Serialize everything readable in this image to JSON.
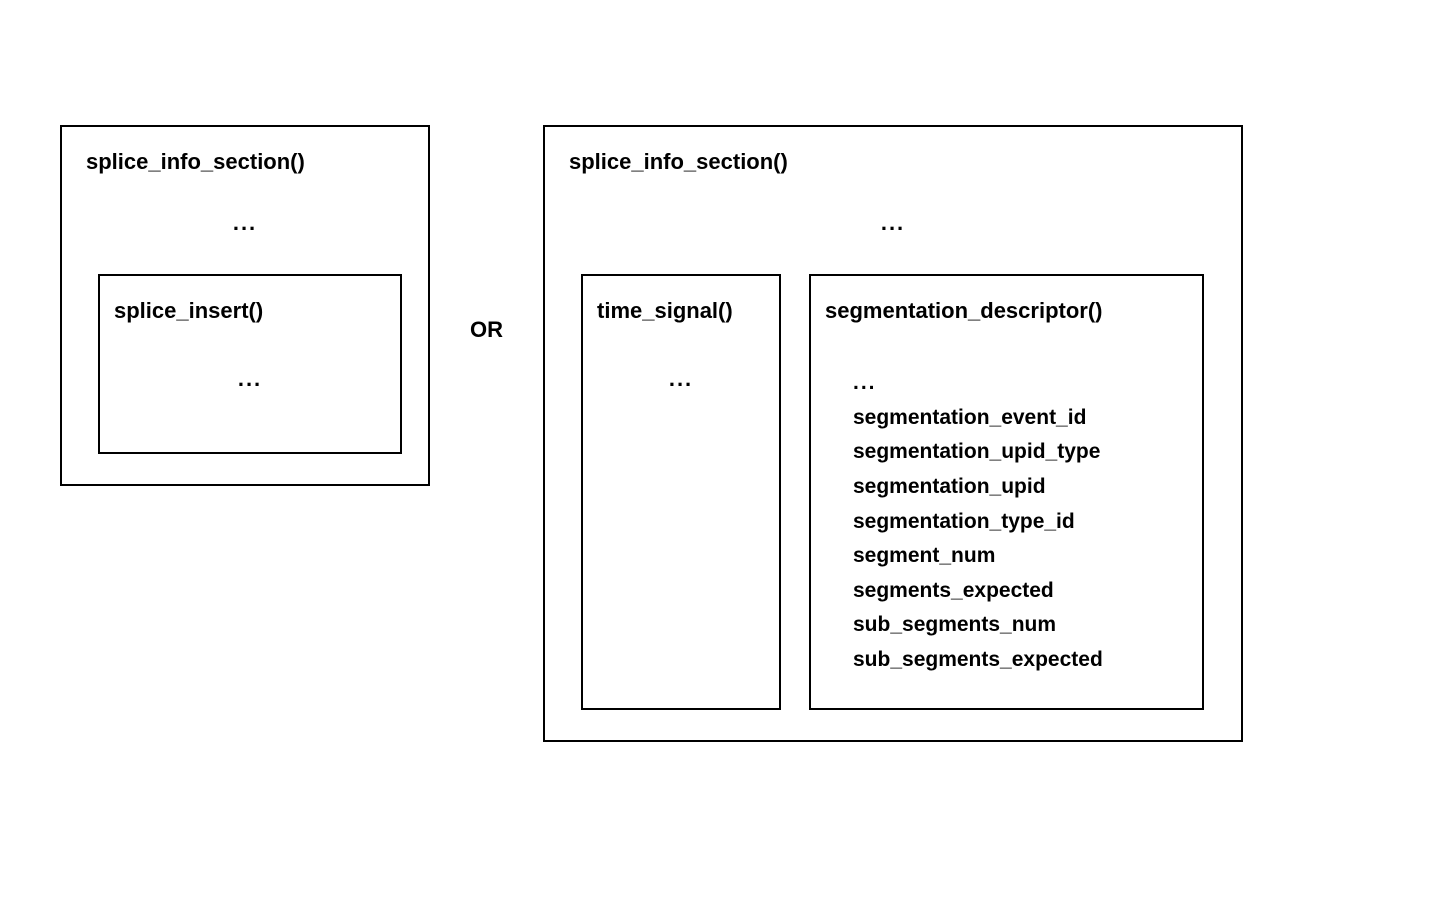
{
  "left": {
    "title": "splice_info_section()",
    "ellipsis": "...",
    "inner": {
      "title": "splice_insert()",
      "ellipsis": "..."
    }
  },
  "separator": "OR",
  "right": {
    "title": "splice_info_section()",
    "ellipsis": "...",
    "time_signal": {
      "title": "time_signal()",
      "ellipsis": "..."
    },
    "segmentation": {
      "title": "segmentation_descriptor()",
      "ellipsis": "...",
      "fields": [
        "segmentation_event_id",
        "segmentation_upid_type",
        "segmentation_upid",
        "segmentation_type_id",
        "segment_num",
        "segments_expected",
        "sub_segments_num",
        "sub_segments_expected"
      ]
    }
  }
}
